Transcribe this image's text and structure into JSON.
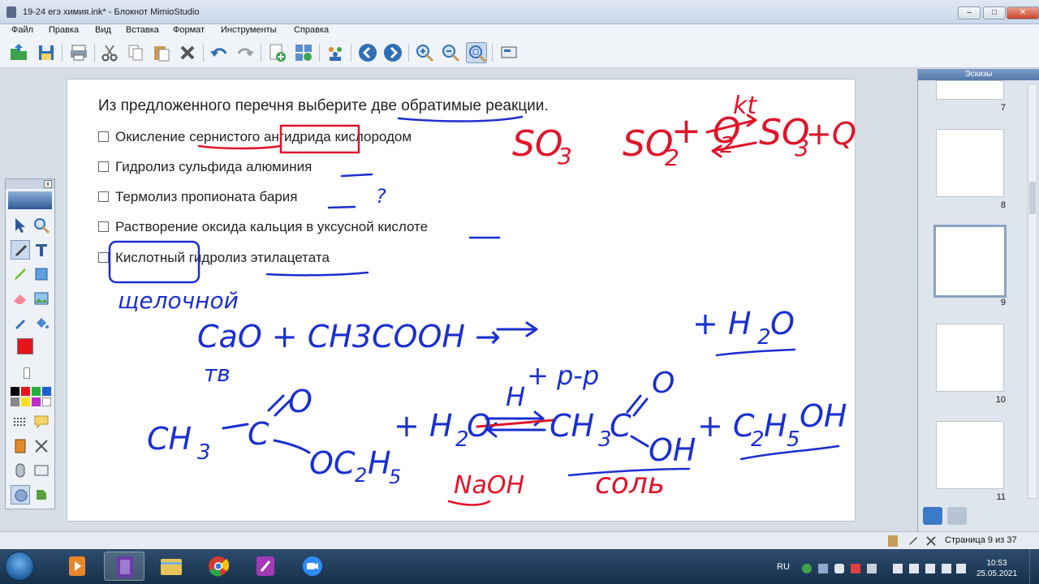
{
  "window": {
    "title": "19-24 егэ химия.ink* - Блокнот MimioStudio"
  },
  "menu": [
    "Файл",
    "Правка",
    "Вид",
    "Вставка",
    "Формат",
    "Инструменты",
    "Справка"
  ],
  "question": {
    "title": "Из предложенного перечня выберите две обратимые реакции.",
    "options": [
      "Окисление сернистого ангидрида кислородом",
      "Гидролиз сульфида алюминия",
      "Термолиз пропионата бария",
      "Растворение оксида кальция в уксусной кислоте",
      "Кислотный гидролиз этилацетата"
    ]
  },
  "handwriting": {
    "so3": "SO",
    "so3_sub": "3",
    "reaction1": "SO",
    "reaction1_sub": "2",
    "reaction1_b": "+ O",
    "reaction1_b_sub": "2",
    "reaction1_c": "SO",
    "reaction1_c_sub": "3",
    "reaction1_d": "+Q",
    "catalyst": "kt",
    "question_mark": "?",
    "alkaline_note": "щелочной",
    "cao_eq": "CaO + CH3COOH →",
    "solid_note": "тв",
    "water_product": "+ H",
    "water_sub": "2",
    "water_o": "O",
    "acid_note": "H",
    "plus_rr": "+ р-р",
    "ester": "CH",
    "ester_sub": "3",
    "ester_c": "C",
    "ester_o": "O",
    "ester_oc": "OC",
    "ester_oc_h": "H",
    "ester_oc_sub1": "2",
    "ester_oc_sub2": "5",
    "plus_h2o": "+ H",
    "plus_h2o_sub": "2",
    "plus_h2o_o": "O",
    "prod_acid": "CH",
    "prod_acid_sub": "3",
    "prod_acid_c": "C",
    "prod_acid_o": "O",
    "prod_acid_oh": "OH",
    "prod_alc": "+ C",
    "prod_alc_sub1": "2",
    "prod_alc_h": "H",
    "prod_alc_sub2": "5",
    "prod_alc_oh": "OH",
    "naoh": "NaOH",
    "salt_note": "соль"
  },
  "sidebar": {
    "header": "Эскизы",
    "thumbnails": [
      "7",
      "8",
      "9",
      "10",
      "11"
    ],
    "selected": "9"
  },
  "status": {
    "page_indicator": "Страница 9 из 37"
  },
  "taskbar": {
    "language": "RU",
    "time": "10:53",
    "date": "25.05.2021"
  },
  "colors": {
    "ink_blue": "#1a2fd0",
    "ink_red": "#e0142a",
    "accent_selected": "#8aa2c2"
  }
}
